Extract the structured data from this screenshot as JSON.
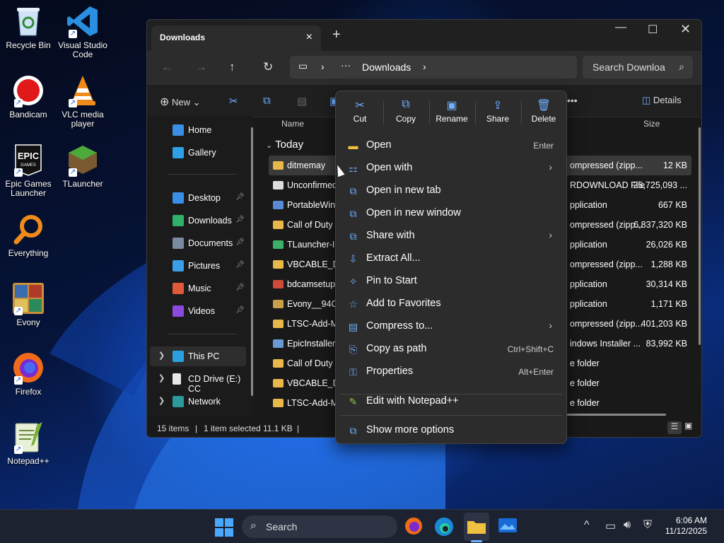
{
  "desktop": {
    "icons": [
      {
        "label": "Recycle Bin",
        "icon": "recycle-bin-icon"
      },
      {
        "label": "Visual Studio Code",
        "icon": "vscode-icon"
      },
      {
        "label": "Bandicam",
        "icon": "bandicam-icon"
      },
      {
        "label": "VLC media player",
        "icon": "vlc-icon"
      },
      {
        "label": "Epic Games Launcher",
        "icon": "epic-games-icon"
      },
      {
        "label": "TLauncher",
        "icon": "tlauncher-icon"
      },
      {
        "label": "Everything",
        "icon": "everything-search-icon"
      },
      {
        "label": "Evony",
        "icon": "evony-icon"
      },
      {
        "label": "Firefox",
        "icon": "firefox-icon"
      },
      {
        "label": "Notepad++",
        "icon": "notepadpp-icon"
      }
    ]
  },
  "explorer": {
    "tab_title": "Downloads",
    "address": {
      "crumb": "Downloads"
    },
    "search_placeholder": "Search Downloa",
    "toolbar": {
      "new_label": "New",
      "details_label": "Details"
    },
    "sidebar": {
      "home": "Home",
      "gallery": "Gallery",
      "pinned": [
        {
          "label": "Desktop",
          "color": "#3a8ee6"
        },
        {
          "label": "Downloads",
          "color": "#2fb06b"
        },
        {
          "label": "Documents",
          "color": "#7a8aa0"
        },
        {
          "label": "Pictures",
          "color": "#3a9ee6"
        },
        {
          "label": "Music",
          "color": "#e05a3a"
        },
        {
          "label": "Videos",
          "color": "#8a4ae0"
        }
      ],
      "this_pc": "This PC",
      "cd_drive": "CD Drive (E:) CC",
      "network": "Network"
    },
    "columns": {
      "name": "Name",
      "type": "pe",
      "size": "Size"
    },
    "group": "Today",
    "files": [
      {
        "name": "ditmemay",
        "type": "ompressed (zipp...",
        "size": "12 KB",
        "color": "#e8b84a",
        "selected": true
      },
      {
        "name": "Unconfirmed",
        "type": "RDOWNLOAD File",
        "size": "25,725,093 ...",
        "color": "#dddddd"
      },
      {
        "name": "PortableWinC",
        "type": "pplication",
        "size": "667 KB",
        "color": "#5a8ad6"
      },
      {
        "name": "Call of Duty 4",
        "type": "ompressed (zipp...",
        "size": "6,837,320 KB",
        "color": "#e8b84a"
      },
      {
        "name": "TLauncher-In",
        "type": "pplication",
        "size": "26,026 KB",
        "color": "#3ab06b"
      },
      {
        "name": "VBCABLE_Driv",
        "type": "ompressed (zipp...",
        "size": "1,288 KB",
        "color": "#e8b84a"
      },
      {
        "name": "bdcamsetup-",
        "type": "pplication",
        "size": "30,314 KB",
        "color": "#d04a3a"
      },
      {
        "name": "Evony__94CV",
        "type": "pplication",
        "size": "1,171 KB",
        "color": "#c8a04a"
      },
      {
        "name": "LTSC-Add-M",
        "type": "ompressed (zipp...",
        "size": "401,203 KB",
        "color": "#e8b84a"
      },
      {
        "name": "EpicInstaller-",
        "type": "indows Installer ...",
        "size": "83,992 KB",
        "color": "#6a9ad6"
      },
      {
        "name": "Call of Duty 4",
        "type": "e folder",
        "size": "",
        "color": "#e8b84a"
      },
      {
        "name": "VBCABLE_Driv",
        "type": "e folder",
        "size": "",
        "color": "#e8b84a"
      },
      {
        "name": "LTSC-Add-M",
        "type": "e folder",
        "size": "",
        "color": "#e8b84a"
      }
    ],
    "status": {
      "items": "15 items",
      "selected": "1 item selected",
      "size": "11.1 KB"
    }
  },
  "context_menu": {
    "quick": [
      {
        "label": "Cut",
        "icon": "scissors-icon"
      },
      {
        "label": "Copy",
        "icon": "copy-icon"
      },
      {
        "label": "Rename",
        "icon": "rename-icon"
      },
      {
        "label": "Share",
        "icon": "share-icon"
      },
      {
        "label": "Delete",
        "icon": "trash-icon"
      }
    ],
    "items": [
      {
        "label": "Open",
        "shortcut": "Enter",
        "submenu": false
      },
      {
        "label": "Open with",
        "shortcut": "",
        "submenu": true
      },
      {
        "label": "Open in new tab",
        "shortcut": "",
        "submenu": false
      },
      {
        "label": "Open in new window",
        "shortcut": "",
        "submenu": false
      },
      {
        "label": "Share with",
        "shortcut": "",
        "submenu": true
      },
      {
        "label": "Extract All...",
        "shortcut": "",
        "submenu": false
      },
      {
        "label": "Pin to Start",
        "shortcut": "",
        "submenu": false
      },
      {
        "label": "Add to Favorites",
        "shortcut": "",
        "submenu": false
      },
      {
        "label": "Compress to...",
        "shortcut": "",
        "submenu": true
      },
      {
        "label": "Copy as path",
        "shortcut": "Ctrl+Shift+C",
        "submenu": false
      },
      {
        "label": "Properties",
        "shortcut": "Alt+Enter",
        "submenu": false
      }
    ],
    "extra": {
      "label": "Edit with Notepad++"
    },
    "more": {
      "label": "Show more options"
    }
  },
  "taskbar": {
    "search_label": "Search",
    "time": "6:06 AM",
    "date": "11/12/2025"
  }
}
